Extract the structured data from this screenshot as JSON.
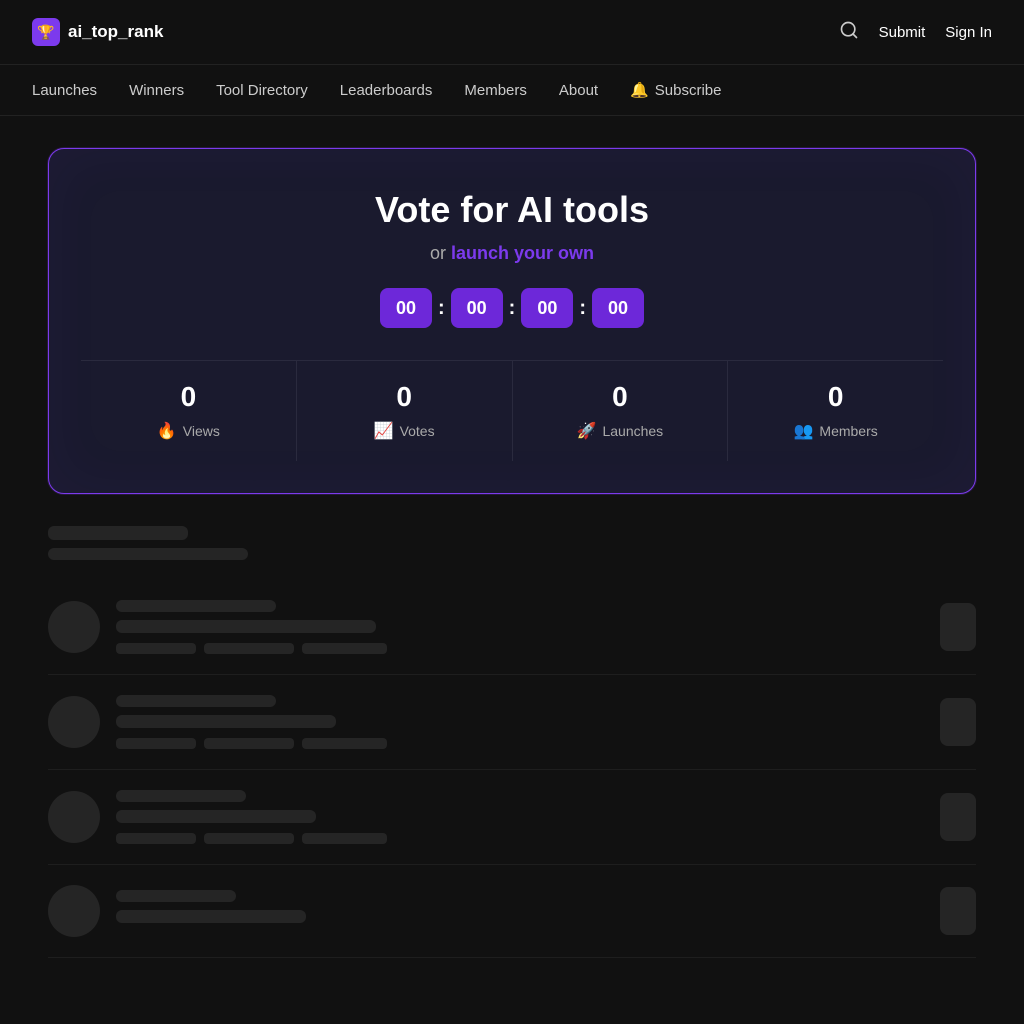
{
  "brand": {
    "logo_text": "ai_top_rank",
    "logo_icon": "🏆"
  },
  "topbar": {
    "submit_label": "Submit",
    "signin_label": "Sign In"
  },
  "nav": {
    "items": [
      {
        "id": "launches",
        "label": "Launches"
      },
      {
        "id": "winners",
        "label": "Winners"
      },
      {
        "id": "tool-directory",
        "label": "Tool Directory"
      },
      {
        "id": "leaderboards",
        "label": "Leaderboards"
      },
      {
        "id": "members",
        "label": "Members"
      },
      {
        "id": "about",
        "label": "About"
      }
    ],
    "subscribe_label": "Subscribe"
  },
  "hero": {
    "title": "Vote for AI tools",
    "subtitle_prefix": "or ",
    "subtitle_link": "launch your own",
    "countdown": {
      "hours": "00",
      "minutes": "00",
      "seconds": "00",
      "ms": "00"
    },
    "stats": [
      {
        "id": "views",
        "value": "0",
        "label": "Views",
        "icon": "🔥"
      },
      {
        "id": "votes",
        "value": "0",
        "label": "Votes",
        "icon": "📈"
      },
      {
        "id": "launches",
        "value": "0",
        "label": "Launches",
        "icon": "🚀"
      },
      {
        "id": "members",
        "value": "0",
        "label": "Members",
        "icon": "👥"
      }
    ]
  },
  "colors": {
    "purple": "#7c3aed",
    "purple_dark": "#6d28d9",
    "bg_card": "#1a1a2e",
    "skeleton": "#252525"
  }
}
